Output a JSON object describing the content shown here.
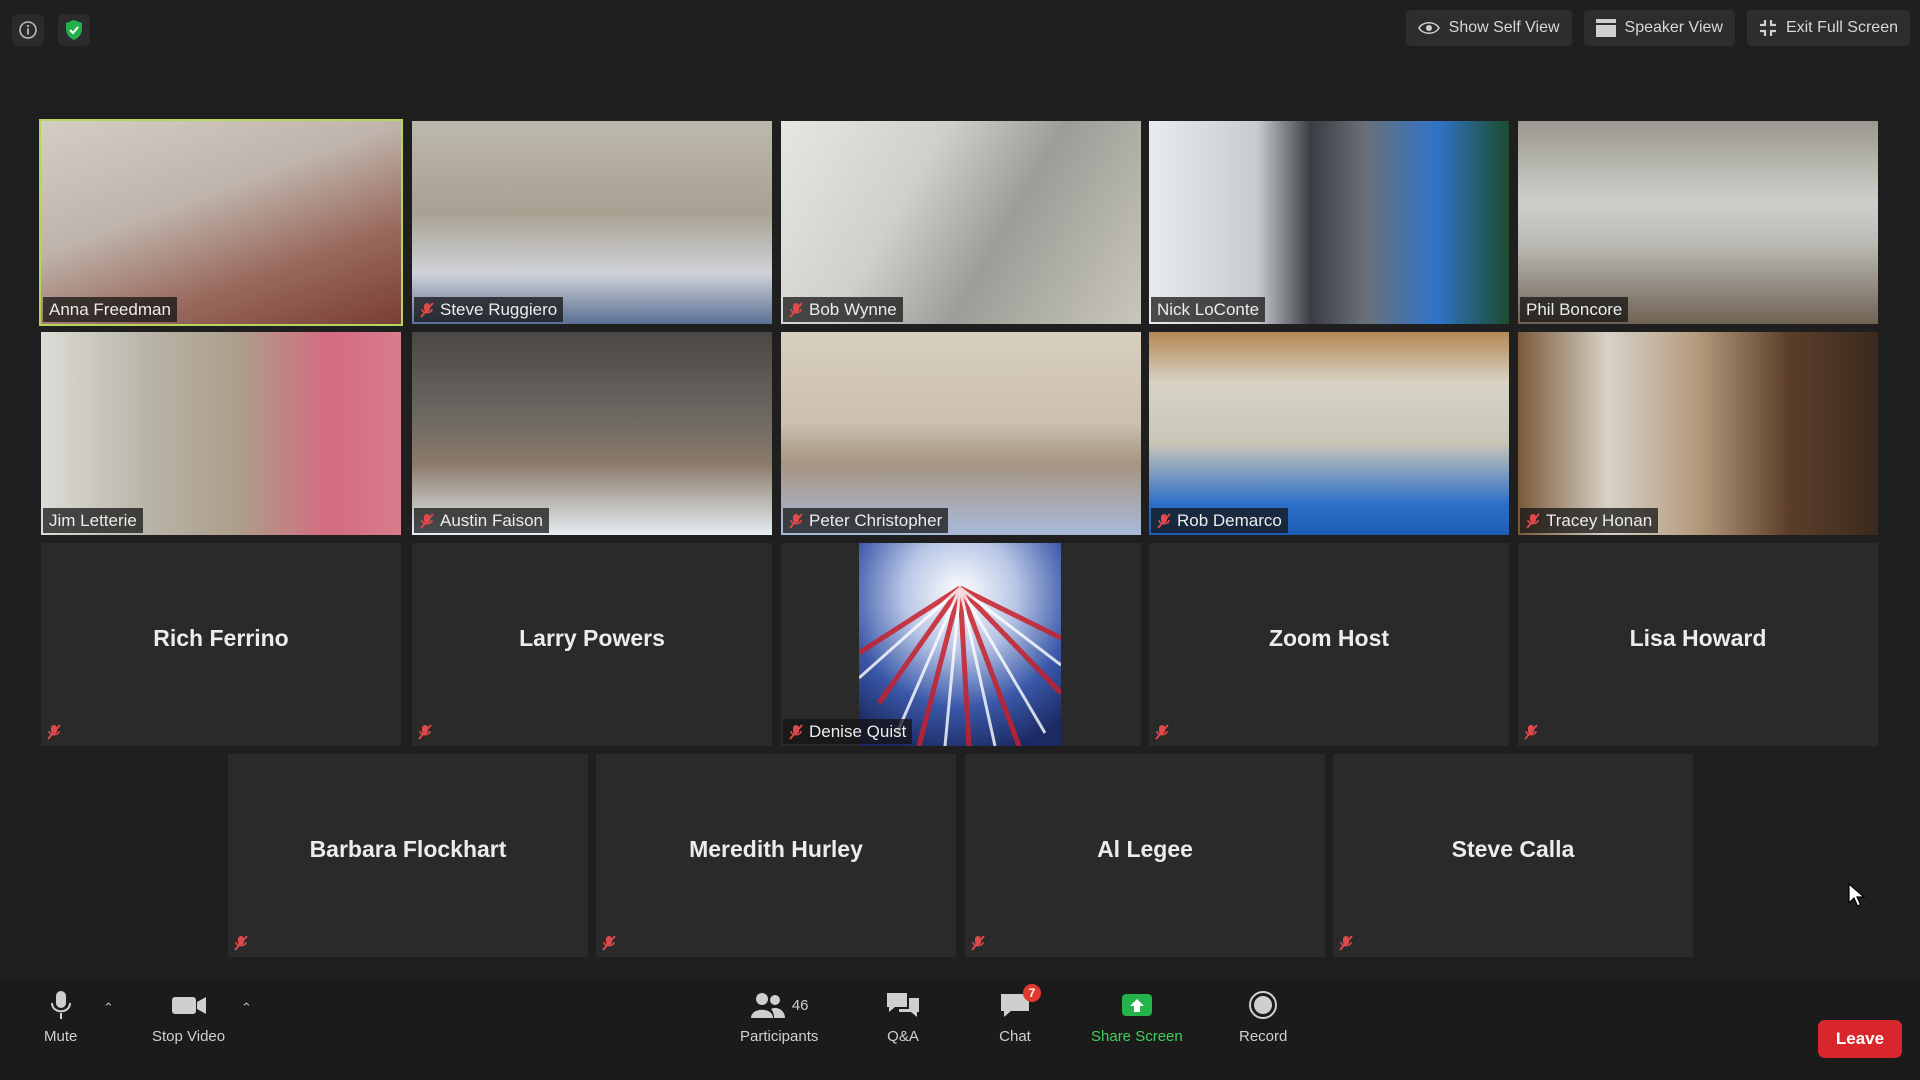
{
  "top_right": {
    "show_self_view": "Show Self View",
    "speaker_view": "Speaker View",
    "exit_full_screen": "Exit Full Screen"
  },
  "tiles": {
    "anna": "Anna Freedman",
    "steve_r": "Steve Ruggiero",
    "bob": "Bob Wynne",
    "nick": "Nick LoConte",
    "phil": "Phil Boncore",
    "jim": "Jim Letterie",
    "austin": "Austin Faison",
    "peter": "Peter Christopher",
    "rob": "Rob Demarco",
    "tracey": "Tracey Honan",
    "rich": "Rich Ferrino",
    "larry": "Larry Powers",
    "denise": "Denise Quist",
    "zoom": "Zoom Host",
    "lisa": "Lisa Howard",
    "barbara": "Barbara Flockhart",
    "meredith": "Meredith Hurley",
    "al": "Al Legee",
    "steve_c": "Steve Calla"
  },
  "toolbar": {
    "mute": "Mute",
    "stop_video": "Stop Video",
    "participants": "Participants",
    "participants_count": "46",
    "qa": "Q&A",
    "chat": "Chat",
    "chat_badge": "7",
    "share_screen": "Share Screen",
    "record": "Record",
    "leave": "Leave"
  }
}
